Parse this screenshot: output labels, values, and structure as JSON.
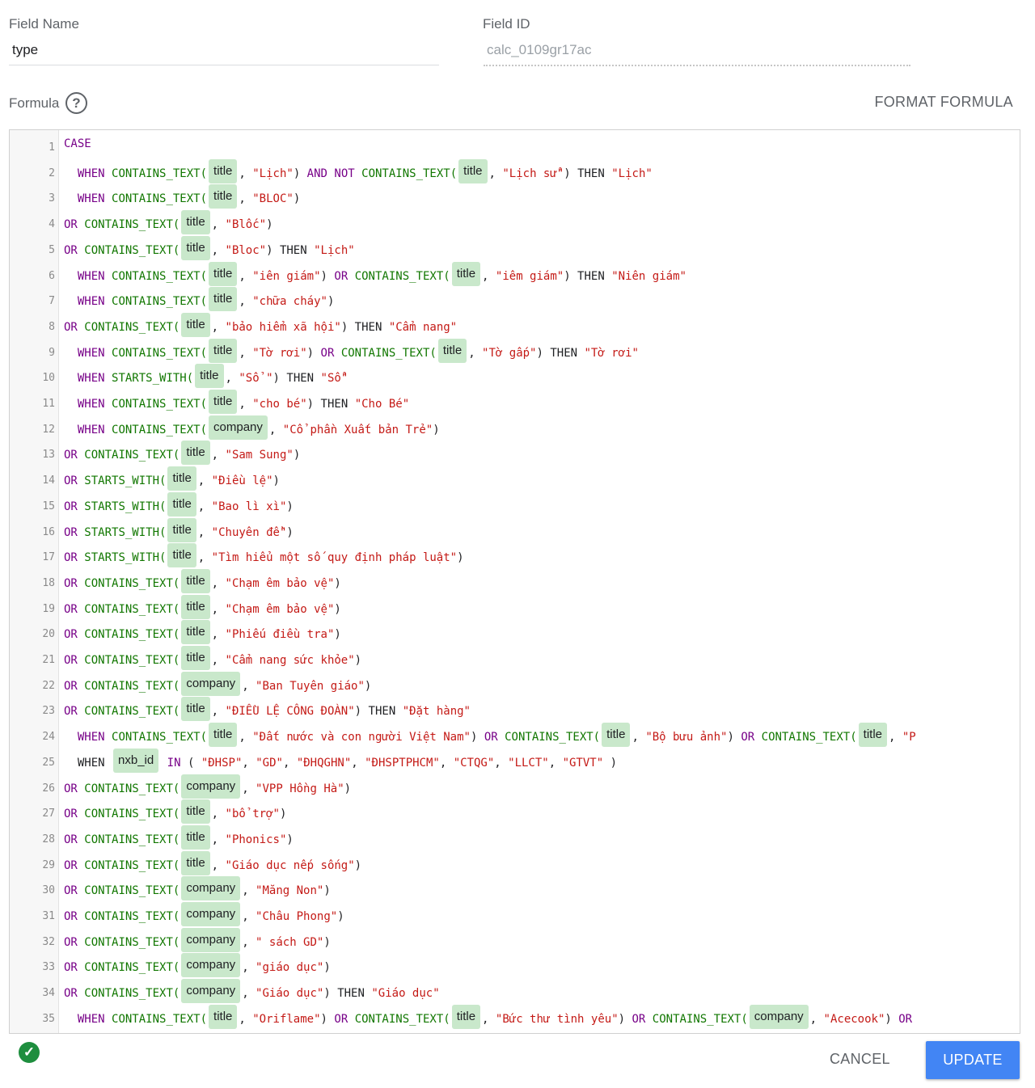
{
  "field_name": {
    "label": "Field Name",
    "value": "type"
  },
  "field_id": {
    "label": "Field ID",
    "value": "calc_0109gr17ac"
  },
  "formula": {
    "label": "Formula",
    "help_icon": "help-circle-icon",
    "format_button": "FORMAT FORMULA"
  },
  "code_lines": [
    [
      [
        "k",
        "CASE"
      ]
    ],
    [
      [
        "t",
        "  "
      ],
      [
        "k",
        "WHEN"
      ],
      [
        "t",
        " "
      ],
      [
        "f",
        "CONTAINS_TEXT("
      ],
      [
        "c",
        "title"
      ],
      [
        "t",
        ", "
      ],
      [
        "s",
        "\"Lịch\""
      ],
      [
        "t",
        ") "
      ],
      [
        "k",
        "AND"
      ],
      [
        "t",
        " "
      ],
      [
        "k",
        "NOT"
      ],
      [
        "t",
        " "
      ],
      [
        "f",
        "CONTAINS_TEXT("
      ],
      [
        "c",
        "title"
      ],
      [
        "t",
        ", "
      ],
      [
        "s",
        "\"Lịch sử\""
      ],
      [
        "t",
        ") "
      ],
      [
        "t",
        "THEN"
      ],
      [
        "t",
        " "
      ],
      [
        "s",
        "\"Lịch\""
      ]
    ],
    [
      [
        "t",
        "  "
      ],
      [
        "k",
        "WHEN"
      ],
      [
        "t",
        " "
      ],
      [
        "f",
        "CONTAINS_TEXT("
      ],
      [
        "c",
        "title"
      ],
      [
        "t",
        ", "
      ],
      [
        "s",
        "\"BLOC\""
      ],
      [
        "t",
        ")"
      ]
    ],
    [
      [
        "k",
        "OR"
      ],
      [
        "t",
        " "
      ],
      [
        "f",
        "CONTAINS_TEXT("
      ],
      [
        "c",
        "title"
      ],
      [
        "t",
        ", "
      ],
      [
        "s",
        "\"Blốc\""
      ],
      [
        "t",
        ")"
      ]
    ],
    [
      [
        "k",
        "OR"
      ],
      [
        "t",
        " "
      ],
      [
        "f",
        "CONTAINS_TEXT("
      ],
      [
        "c",
        "title"
      ],
      [
        "t",
        ", "
      ],
      [
        "s",
        "\"Bloc\""
      ],
      [
        "t",
        ") THEN "
      ],
      [
        "s",
        "\"Lịch\""
      ]
    ],
    [
      [
        "t",
        "  "
      ],
      [
        "k",
        "WHEN"
      ],
      [
        "t",
        " "
      ],
      [
        "f",
        "CONTAINS_TEXT("
      ],
      [
        "c",
        "title"
      ],
      [
        "t",
        ", "
      ],
      [
        "s",
        "\"iên giám\""
      ],
      [
        "t",
        ") "
      ],
      [
        "k",
        "OR"
      ],
      [
        "t",
        " "
      ],
      [
        "f",
        "CONTAINS_TEXT("
      ],
      [
        "c",
        "title"
      ],
      [
        "t",
        ", "
      ],
      [
        "s",
        "\"iêm giám\""
      ],
      [
        "t",
        ") THEN "
      ],
      [
        "s",
        "\"Niên giám\""
      ]
    ],
    [
      [
        "t",
        "  "
      ],
      [
        "k",
        "WHEN"
      ],
      [
        "t",
        " "
      ],
      [
        "f",
        "CONTAINS_TEXT("
      ],
      [
        "c",
        "title"
      ],
      [
        "t",
        ", "
      ],
      [
        "s",
        "\"chữa cháy\""
      ],
      [
        "t",
        ")"
      ]
    ],
    [
      [
        "k",
        "OR"
      ],
      [
        "t",
        " "
      ],
      [
        "f",
        "CONTAINS_TEXT("
      ],
      [
        "c",
        "title"
      ],
      [
        "t",
        ", "
      ],
      [
        "s",
        "\"bảo hiểm xã hội\""
      ],
      [
        "t",
        ") THEN "
      ],
      [
        "s",
        "\"Cẩm nang\""
      ]
    ],
    [
      [
        "t",
        "  "
      ],
      [
        "k",
        "WHEN"
      ],
      [
        "t",
        " "
      ],
      [
        "f",
        "CONTAINS_TEXT("
      ],
      [
        "c",
        "title"
      ],
      [
        "t",
        ", "
      ],
      [
        "s",
        "\"Tờ rơi\""
      ],
      [
        "t",
        ") "
      ],
      [
        "k",
        "OR"
      ],
      [
        "t",
        " "
      ],
      [
        "f",
        "CONTAINS_TEXT("
      ],
      [
        "c",
        "title"
      ],
      [
        "t",
        ", "
      ],
      [
        "s",
        "\"Tờ gấp\""
      ],
      [
        "t",
        ") THEN "
      ],
      [
        "s",
        "\"Tờ rơi\""
      ]
    ],
    [
      [
        "t",
        "  "
      ],
      [
        "k",
        "WHEN"
      ],
      [
        "t",
        " "
      ],
      [
        "f",
        "STARTS_WITH("
      ],
      [
        "c",
        "title"
      ],
      [
        "t",
        ", "
      ],
      [
        "s",
        "\"Sổ \""
      ],
      [
        "t",
        ") THEN "
      ],
      [
        "s",
        "\"Sổ\""
      ]
    ],
    [
      [
        "t",
        "  "
      ],
      [
        "k",
        "WHEN"
      ],
      [
        "t",
        " "
      ],
      [
        "f",
        "CONTAINS_TEXT("
      ],
      [
        "c",
        "title"
      ],
      [
        "t",
        ", "
      ],
      [
        "s",
        "\"cho bé\""
      ],
      [
        "t",
        ") THEN "
      ],
      [
        "s",
        "\"Cho Bé\""
      ]
    ],
    [
      [
        "t",
        "  "
      ],
      [
        "k",
        "WHEN"
      ],
      [
        "t",
        " "
      ],
      [
        "f",
        "CONTAINS_TEXT("
      ],
      [
        "c",
        "company"
      ],
      [
        "t",
        ", "
      ],
      [
        "s",
        "\"Cổ phần Xuất bản Trẻ\""
      ],
      [
        "t",
        ")"
      ]
    ],
    [
      [
        "k",
        "OR"
      ],
      [
        "t",
        " "
      ],
      [
        "f",
        "CONTAINS_TEXT("
      ],
      [
        "c",
        "title"
      ],
      [
        "t",
        ", "
      ],
      [
        "s",
        "\"Sam Sung\""
      ],
      [
        "t",
        ")"
      ]
    ],
    [
      [
        "k",
        "OR"
      ],
      [
        "t",
        " "
      ],
      [
        "f",
        "STARTS_WITH("
      ],
      [
        "c",
        "title"
      ],
      [
        "t",
        ", "
      ],
      [
        "s",
        "\"Điều lệ\""
      ],
      [
        "t",
        ")"
      ]
    ],
    [
      [
        "k",
        "OR"
      ],
      [
        "t",
        " "
      ],
      [
        "f",
        "STARTS_WITH("
      ],
      [
        "c",
        "title"
      ],
      [
        "t",
        ", "
      ],
      [
        "s",
        "\"Bao lì xì\""
      ],
      [
        "t",
        ")"
      ]
    ],
    [
      [
        "k",
        "OR"
      ],
      [
        "t",
        " "
      ],
      [
        "f",
        "STARTS_WITH("
      ],
      [
        "c",
        "title"
      ],
      [
        "t",
        ", "
      ],
      [
        "s",
        "\"Chuyên đề\""
      ],
      [
        "t",
        ")"
      ]
    ],
    [
      [
        "k",
        "OR"
      ],
      [
        "t",
        " "
      ],
      [
        "f",
        "STARTS_WITH("
      ],
      [
        "c",
        "title"
      ],
      [
        "t",
        ", "
      ],
      [
        "s",
        "\"Tìm hiểu một số quy định pháp luật\""
      ],
      [
        "t",
        ")"
      ]
    ],
    [
      [
        "k",
        "OR"
      ],
      [
        "t",
        " "
      ],
      [
        "f",
        "CONTAINS_TEXT("
      ],
      [
        "c",
        "title"
      ],
      [
        "t",
        ", "
      ],
      [
        "s",
        "\"Chạm êm bảo vệ\""
      ],
      [
        "t",
        ")"
      ]
    ],
    [
      [
        "k",
        "OR"
      ],
      [
        "t",
        " "
      ],
      [
        "f",
        "CONTAINS_TEXT("
      ],
      [
        "c",
        "title"
      ],
      [
        "t",
        ", "
      ],
      [
        "s",
        "\"Chạm êm bảo vệ\""
      ],
      [
        "t",
        ")"
      ]
    ],
    [
      [
        "k",
        "OR"
      ],
      [
        "t",
        " "
      ],
      [
        "f",
        "CONTAINS_TEXT("
      ],
      [
        "c",
        "title"
      ],
      [
        "t",
        ", "
      ],
      [
        "s",
        "\"Phiếu điều tra\""
      ],
      [
        "t",
        ")"
      ]
    ],
    [
      [
        "k",
        "OR"
      ],
      [
        "t",
        " "
      ],
      [
        "f",
        "CONTAINS_TEXT("
      ],
      [
        "c",
        "title"
      ],
      [
        "t",
        ", "
      ],
      [
        "s",
        "\"Cẩm nang sức khỏe\""
      ],
      [
        "t",
        ")"
      ]
    ],
    [
      [
        "k",
        "OR"
      ],
      [
        "t",
        " "
      ],
      [
        "f",
        "CONTAINS_TEXT("
      ],
      [
        "c",
        "company"
      ],
      [
        "t",
        ", "
      ],
      [
        "s",
        "\"Ban Tuyên giáo\""
      ],
      [
        "t",
        ")"
      ]
    ],
    [
      [
        "k",
        "OR"
      ],
      [
        "t",
        " "
      ],
      [
        "f",
        "CONTAINS_TEXT("
      ],
      [
        "c",
        "title"
      ],
      [
        "t",
        ", "
      ],
      [
        "s",
        "\"ĐIỀU LỆ CÔNG ĐOÀN\""
      ],
      [
        "t",
        ") THEN "
      ],
      [
        "s",
        "\"Đặt hàng\""
      ]
    ],
    [
      [
        "t",
        "  "
      ],
      [
        "k",
        "WHEN"
      ],
      [
        "t",
        " "
      ],
      [
        "f",
        "CONTAINS_TEXT("
      ],
      [
        "c",
        "title"
      ],
      [
        "t",
        ", "
      ],
      [
        "s",
        "\"Đất nước và con người Việt Nam\""
      ],
      [
        "t",
        ") "
      ],
      [
        "k",
        "OR"
      ],
      [
        "t",
        " "
      ],
      [
        "f",
        "CONTAINS_TEXT("
      ],
      [
        "c",
        "title"
      ],
      [
        "t",
        ", "
      ],
      [
        "s",
        "\"Bộ bưu ảnh\""
      ],
      [
        "t",
        ") "
      ],
      [
        "k",
        "OR"
      ],
      [
        "t",
        " "
      ],
      [
        "f",
        "CONTAINS_TEXT("
      ],
      [
        "c",
        "title"
      ],
      [
        "t",
        ", "
      ],
      [
        "s",
        "\"P"
      ]
    ],
    [
      [
        "t",
        "  WHEN "
      ],
      [
        "c",
        "nxb_id"
      ],
      [
        "t",
        " "
      ],
      [
        "k",
        "IN"
      ],
      [
        "t",
        " ( "
      ],
      [
        "s",
        "\"ĐHSP\""
      ],
      [
        "t",
        ", "
      ],
      [
        "s",
        "\"GD\""
      ],
      [
        "t",
        ", "
      ],
      [
        "s",
        "\"ĐHQGHN\""
      ],
      [
        "t",
        ", "
      ],
      [
        "s",
        "\"ĐHSPTPHCM\""
      ],
      [
        "t",
        ", "
      ],
      [
        "s",
        "\"CTQG\""
      ],
      [
        "t",
        ", "
      ],
      [
        "s",
        "\"LLCT\""
      ],
      [
        "t",
        ", "
      ],
      [
        "s",
        "\"GTVT\""
      ],
      [
        "t",
        " )"
      ]
    ],
    [
      [
        "k",
        "OR"
      ],
      [
        "t",
        " "
      ],
      [
        "f",
        "CONTAINS_TEXT("
      ],
      [
        "c",
        "company"
      ],
      [
        "t",
        ", "
      ],
      [
        "s",
        "\"VPP Hồng Hà\""
      ],
      [
        "t",
        ")"
      ]
    ],
    [
      [
        "k",
        "OR"
      ],
      [
        "t",
        " "
      ],
      [
        "f",
        "CONTAINS_TEXT("
      ],
      [
        "c",
        "title"
      ],
      [
        "t",
        ", "
      ],
      [
        "s",
        "\"bổ trợ\""
      ],
      [
        "t",
        ")"
      ]
    ],
    [
      [
        "k",
        "OR"
      ],
      [
        "t",
        " "
      ],
      [
        "f",
        "CONTAINS_TEXT("
      ],
      [
        "c",
        "title"
      ],
      [
        "t",
        ", "
      ],
      [
        "s",
        "\"Phonics\""
      ],
      [
        "t",
        ")"
      ]
    ],
    [
      [
        "k",
        "OR"
      ],
      [
        "t",
        " "
      ],
      [
        "f",
        "CONTAINS_TEXT("
      ],
      [
        "c",
        "title"
      ],
      [
        "t",
        ", "
      ],
      [
        "s",
        "\"Giáo dục nếp sống\""
      ],
      [
        "t",
        ")"
      ]
    ],
    [
      [
        "k",
        "OR"
      ],
      [
        "t",
        " "
      ],
      [
        "f",
        "CONTAINS_TEXT("
      ],
      [
        "c",
        "company"
      ],
      [
        "t",
        ", "
      ],
      [
        "s",
        "\"Măng Non\""
      ],
      [
        "t",
        ")"
      ]
    ],
    [
      [
        "k",
        "OR"
      ],
      [
        "t",
        " "
      ],
      [
        "f",
        "CONTAINS_TEXT("
      ],
      [
        "c",
        "company"
      ],
      [
        "t",
        ", "
      ],
      [
        "s",
        "\"Châu Phong\""
      ],
      [
        "t",
        ")"
      ]
    ],
    [
      [
        "k",
        "OR"
      ],
      [
        "t",
        " "
      ],
      [
        "f",
        "CONTAINS_TEXT("
      ],
      [
        "c",
        "company"
      ],
      [
        "t",
        ", "
      ],
      [
        "s",
        "\" sách GD\""
      ],
      [
        "t",
        ")"
      ]
    ],
    [
      [
        "k",
        "OR"
      ],
      [
        "t",
        " "
      ],
      [
        "f",
        "CONTAINS_TEXT("
      ],
      [
        "c",
        "company"
      ],
      [
        "t",
        ", "
      ],
      [
        "s",
        "\"giáo dục\""
      ],
      [
        "t",
        ")"
      ]
    ],
    [
      [
        "k",
        "OR"
      ],
      [
        "t",
        " "
      ],
      [
        "f",
        "CONTAINS_TEXT("
      ],
      [
        "c",
        "company"
      ],
      [
        "t",
        ", "
      ],
      [
        "s",
        "\"Giáo dục\""
      ],
      [
        "t",
        ") THEN "
      ],
      [
        "s",
        "\"Giáo dục\""
      ]
    ],
    [
      [
        "t",
        "  "
      ],
      [
        "k",
        "WHEN"
      ],
      [
        "t",
        " "
      ],
      [
        "f",
        "CONTAINS_TEXT("
      ],
      [
        "c",
        "title"
      ],
      [
        "t",
        ", "
      ],
      [
        "s",
        "\"Oriflame\""
      ],
      [
        "t",
        ") "
      ],
      [
        "k",
        "OR"
      ],
      [
        "t",
        " "
      ],
      [
        "f",
        "CONTAINS_TEXT("
      ],
      [
        "c",
        "title"
      ],
      [
        "t",
        ", "
      ],
      [
        "s",
        "\"Bức thư tình yêu\""
      ],
      [
        "t",
        ") "
      ],
      [
        "k",
        "OR"
      ],
      [
        "t",
        " "
      ],
      [
        "f",
        "CONTAINS_TEXT("
      ],
      [
        "c",
        "company"
      ],
      [
        "t",
        ", "
      ],
      [
        "s",
        "\"Acecook\""
      ],
      [
        "t",
        ") "
      ],
      [
        "k",
        "OR"
      ]
    ]
  ],
  "footer": {
    "status_icon": "check-circle-icon",
    "cancel_label": "CANCEL",
    "update_label": "UPDATE"
  },
  "colors": {
    "accent": "#4285f4",
    "chip": "#c9e8cb",
    "keyword": "#770088",
    "function": "#117700",
    "string": "#c41a16",
    "ok": "#1e8e3e"
  }
}
